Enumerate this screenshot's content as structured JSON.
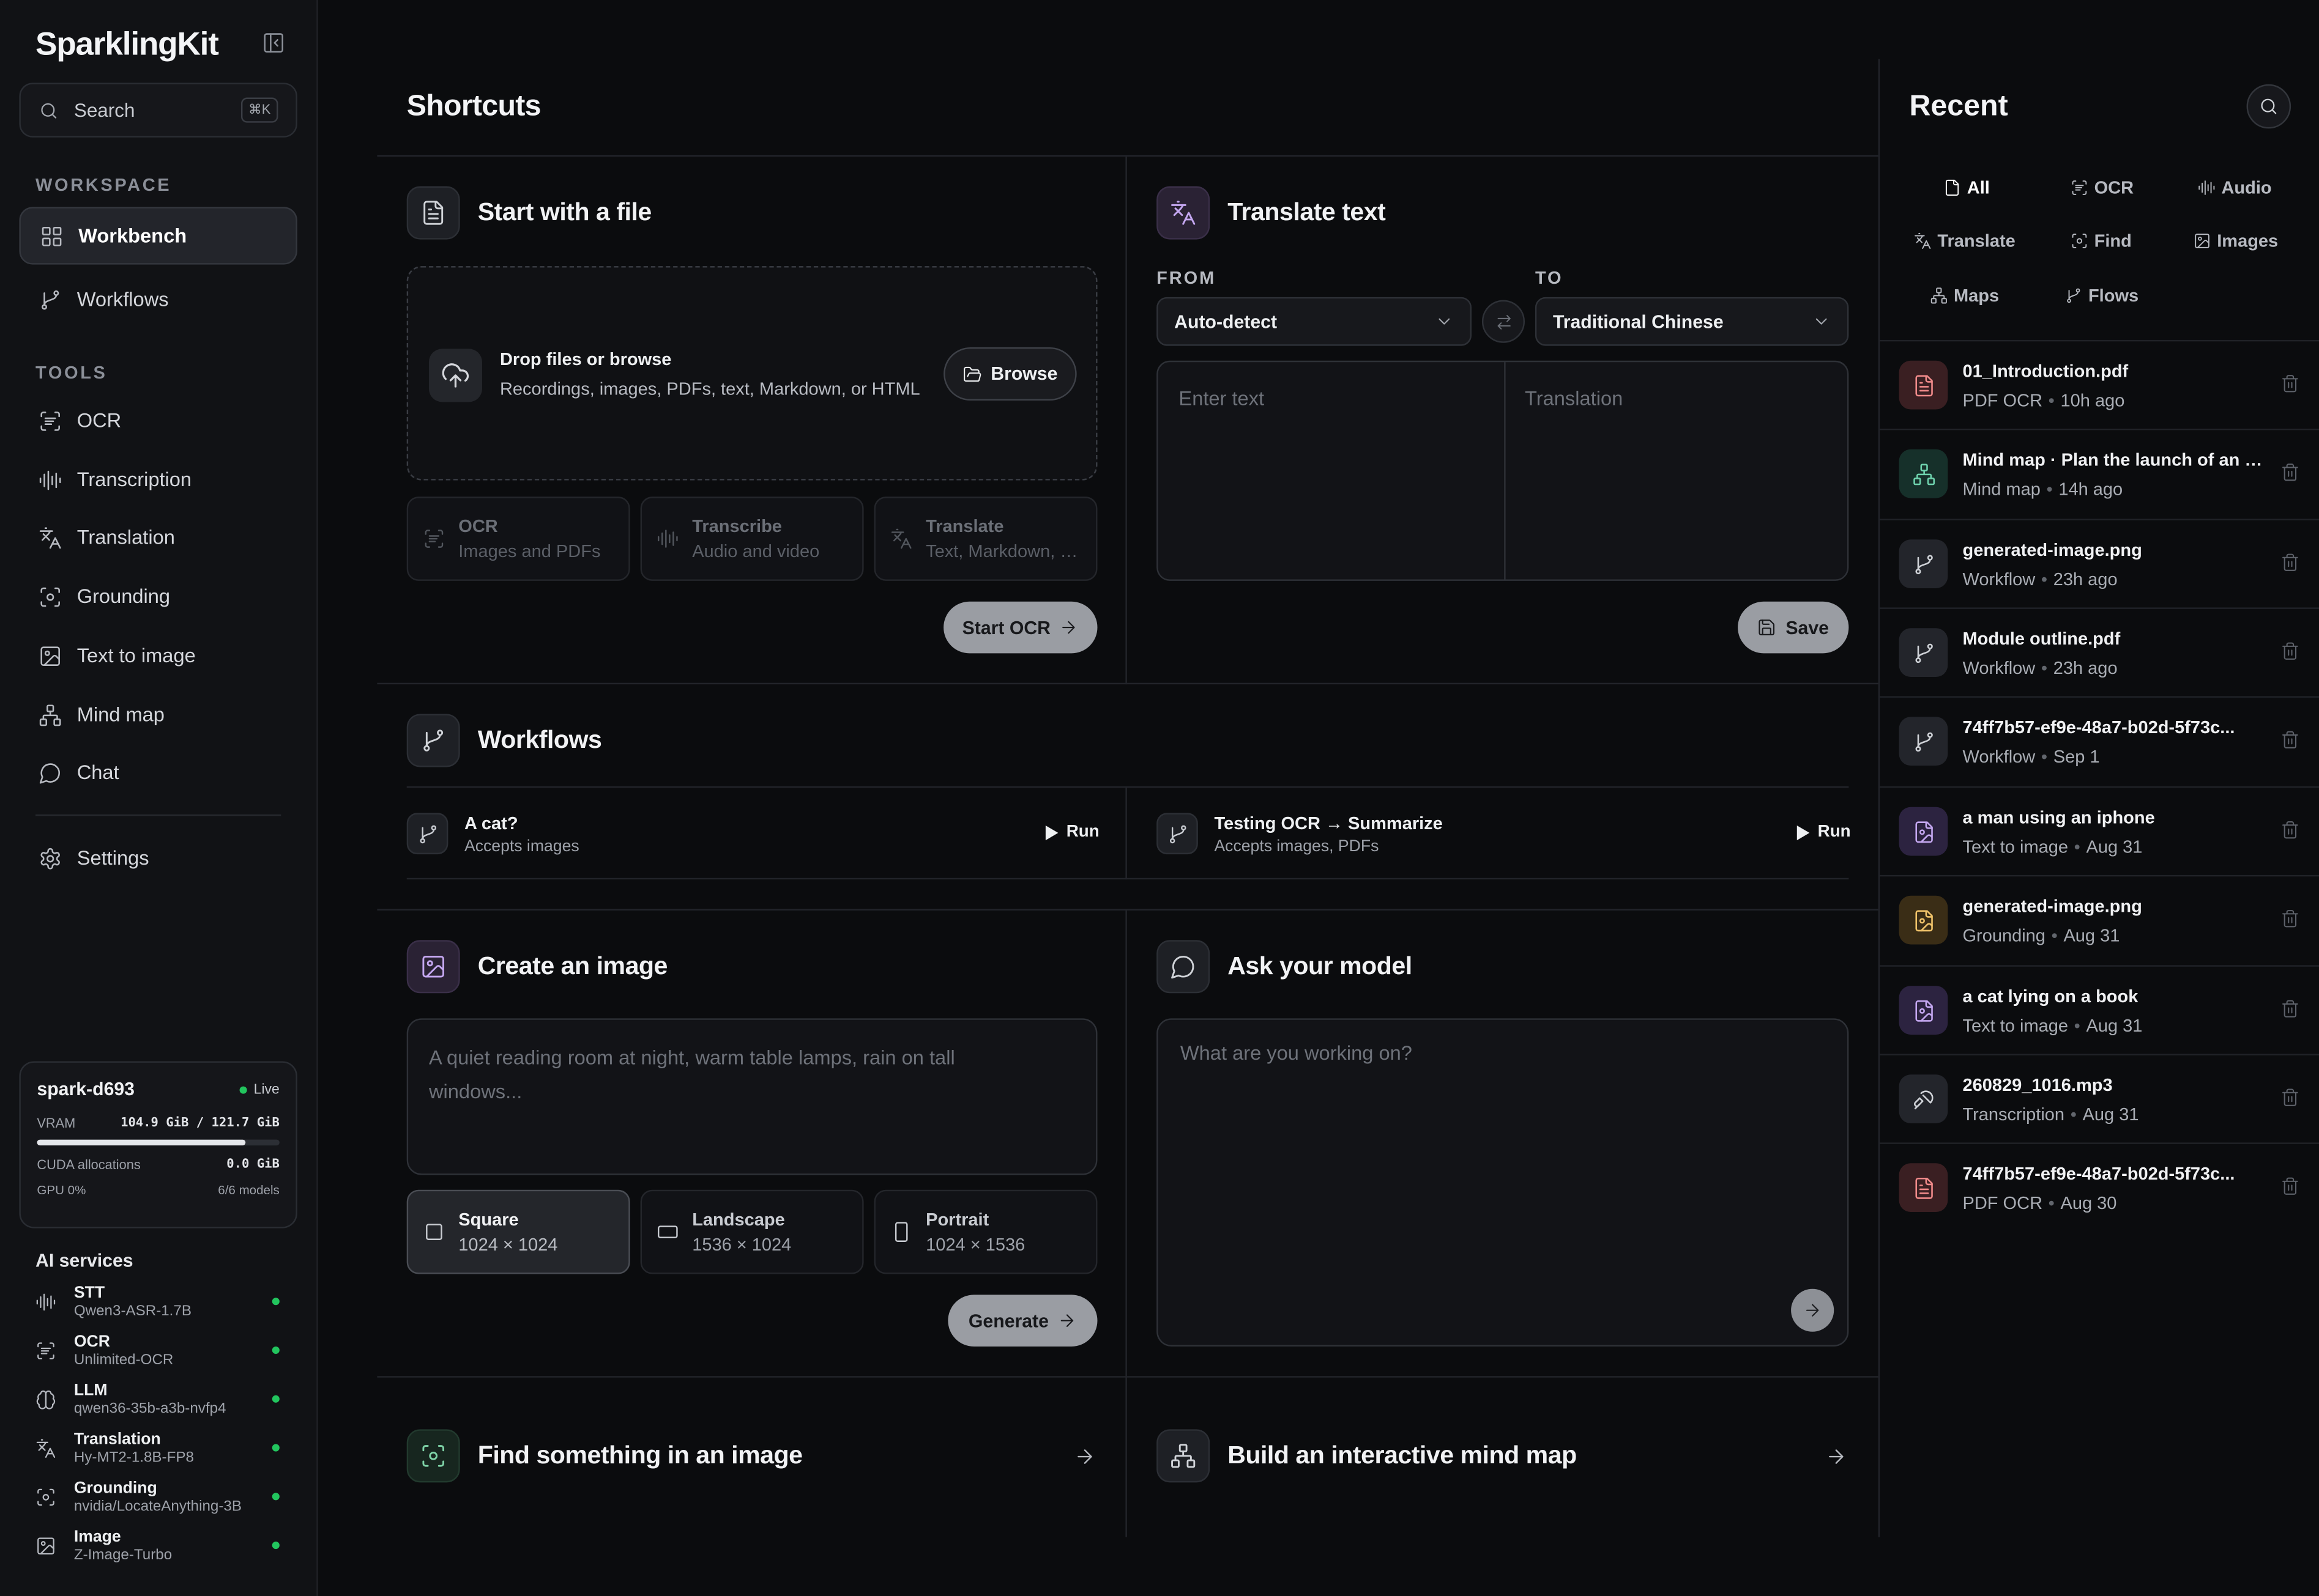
{
  "app": {
    "brand": "SparklingKit"
  },
  "search": {
    "label": "Search",
    "shortcut": "⌘K"
  },
  "sidebar": {
    "workspace_label": "WORKSPACE",
    "workspace": [
      {
        "label": "Workbench",
        "icon": "grid-icon",
        "active": true
      },
      {
        "label": "Workflows",
        "icon": "branch-icon"
      }
    ],
    "tools_label": "TOOLS",
    "tools": [
      {
        "label": "OCR",
        "icon": "scan-text-icon"
      },
      {
        "label": "Transcription",
        "icon": "audio-wave-icon"
      },
      {
        "label": "Translation",
        "icon": "translate-icon"
      },
      {
        "label": "Grounding",
        "icon": "focus-icon"
      },
      {
        "label": "Text to image",
        "icon": "image-icon"
      },
      {
        "label": "Mind map",
        "icon": "network-icon"
      },
      {
        "label": "Chat",
        "icon": "chat-icon"
      }
    ],
    "settings": "Settings"
  },
  "device": {
    "name": "spark-d693",
    "status": "Live",
    "vram_label": "VRAM",
    "vram_value": "104.9 GiB / 121.7 GiB",
    "vram_fraction": 0.862,
    "cuda_label": "CUDA allocations",
    "cuda_value": "0.0 GiB",
    "gpu_label": "GPU 0%",
    "models": "6/6 models"
  },
  "services": {
    "title": "AI services",
    "items": [
      {
        "name": "STT",
        "model": "Qwen3-ASR-1.7B",
        "icon": "audio-wave-icon"
      },
      {
        "name": "OCR",
        "model": "Unlimited-OCR",
        "icon": "scan-text-icon"
      },
      {
        "name": "LLM",
        "model": "qwen36-35b-a3b-nvfp4",
        "icon": "brain-icon"
      },
      {
        "name": "Translation",
        "model": "Hy-MT2-1.8B-FP8",
        "icon": "translate-icon"
      },
      {
        "name": "Grounding",
        "model": "nvidia/LocateAnything-3B",
        "icon": "focus-icon"
      },
      {
        "name": "Image",
        "model": "Z-Image-Turbo",
        "icon": "image-icon"
      }
    ]
  },
  "main": {
    "title": "Shortcuts",
    "file": {
      "title": "Start with a file",
      "drop_title": "Drop files or browse",
      "drop_sub": "Recordings, images, PDFs, text, Markdown, or HTML",
      "browse": "Browse",
      "tiles": [
        {
          "title": "OCR",
          "sub": "Images and PDFs"
        },
        {
          "title": "Transcribe",
          "sub": "Audio and video"
        },
        {
          "title": "Translate",
          "sub": "Text, Markdown, HTML"
        }
      ],
      "start": "Start OCR"
    },
    "translate": {
      "title": "Translate text",
      "from_label": "FROM",
      "to_label": "TO",
      "from": "Auto-detect",
      "to": "Traditional Chinese",
      "input_ph": "Enter text",
      "output_ph": "Translation",
      "save": "Save"
    },
    "workflows": {
      "title": "Workflows",
      "run": "Run",
      "items": [
        {
          "name": "A cat?",
          "accepts": "Accepts images"
        },
        {
          "name": "Testing OCR → Summarize",
          "accepts": "Accepts images, PDFs"
        }
      ]
    },
    "image": {
      "title": "Create an image",
      "prompt_ph": "A quiet reading room at night, warm table lamps, rain on tall windows...",
      "sizes": [
        {
          "name": "Square",
          "dims": "1024 × 1024"
        },
        {
          "name": "Landscape",
          "dims": "1536 × 1024"
        },
        {
          "name": "Portrait",
          "dims": "1024 × 1536"
        }
      ],
      "generate": "Generate"
    },
    "ask": {
      "title": "Ask your model",
      "prompt_ph": "What are you working on?"
    },
    "find": {
      "title": "Find something in an image"
    },
    "mindmap": {
      "title": "Build an interactive mind map"
    }
  },
  "recent": {
    "title": "Recent",
    "filters": [
      {
        "label": "All",
        "icon": "file-icon"
      },
      {
        "label": "OCR",
        "icon": "scan-text-icon"
      },
      {
        "label": "Audio",
        "icon": "audio-wave-icon"
      },
      {
        "label": "Translate",
        "icon": "translate-icon"
      },
      {
        "label": "Find",
        "icon": "focus-icon"
      },
      {
        "label": "Images",
        "icon": "image-icon"
      },
      {
        "label": "Maps",
        "icon": "network-icon"
      },
      {
        "label": "Flows",
        "icon": "branch-icon"
      }
    ],
    "items": [
      {
        "name": "01_Introduction.pdf",
        "type": "PDF OCR",
        "time": "10h ago",
        "color": "red",
        "icon": "file-text-icon"
      },
      {
        "name": "Mind map · Plan the launch of an app",
        "type": "Mind map",
        "time": "14h ago",
        "color": "green",
        "icon": "network-icon"
      },
      {
        "name": "generated-image.png",
        "type": "Workflow",
        "time": "23h ago",
        "color": "grey",
        "icon": "branch-icon"
      },
      {
        "name": "Module outline.pdf",
        "type": "Workflow",
        "time": "23h ago",
        "color": "grey",
        "icon": "branch-icon"
      },
      {
        "name": "74ff7b57-ef9e-48a7-b02d-5f73c...",
        "type": "Workflow",
        "time": "Sep 1",
        "color": "grey",
        "icon": "branch-icon"
      },
      {
        "name": "a man using an iphone",
        "type": "Text to image",
        "time": "Aug 31",
        "color": "purple",
        "icon": "file-image-icon"
      },
      {
        "name": "generated-image.png",
        "type": "Grounding",
        "time": "Aug 31",
        "color": "amber",
        "icon": "file-image-icon"
      },
      {
        "name": "a cat lying on a book",
        "type": "Text to image",
        "time": "Aug 31",
        "color": "purple",
        "icon": "file-image-icon"
      },
      {
        "name": "260829_1016.mp3",
        "type": "Transcription",
        "time": "Aug 31",
        "color": "grey",
        "icon": "mic-icon"
      },
      {
        "name": "74ff7b57-ef9e-48a7-b02d-5f73c...",
        "type": "PDF OCR",
        "time": "Aug 30",
        "color": "red",
        "icon": "file-text-icon"
      }
    ]
  }
}
